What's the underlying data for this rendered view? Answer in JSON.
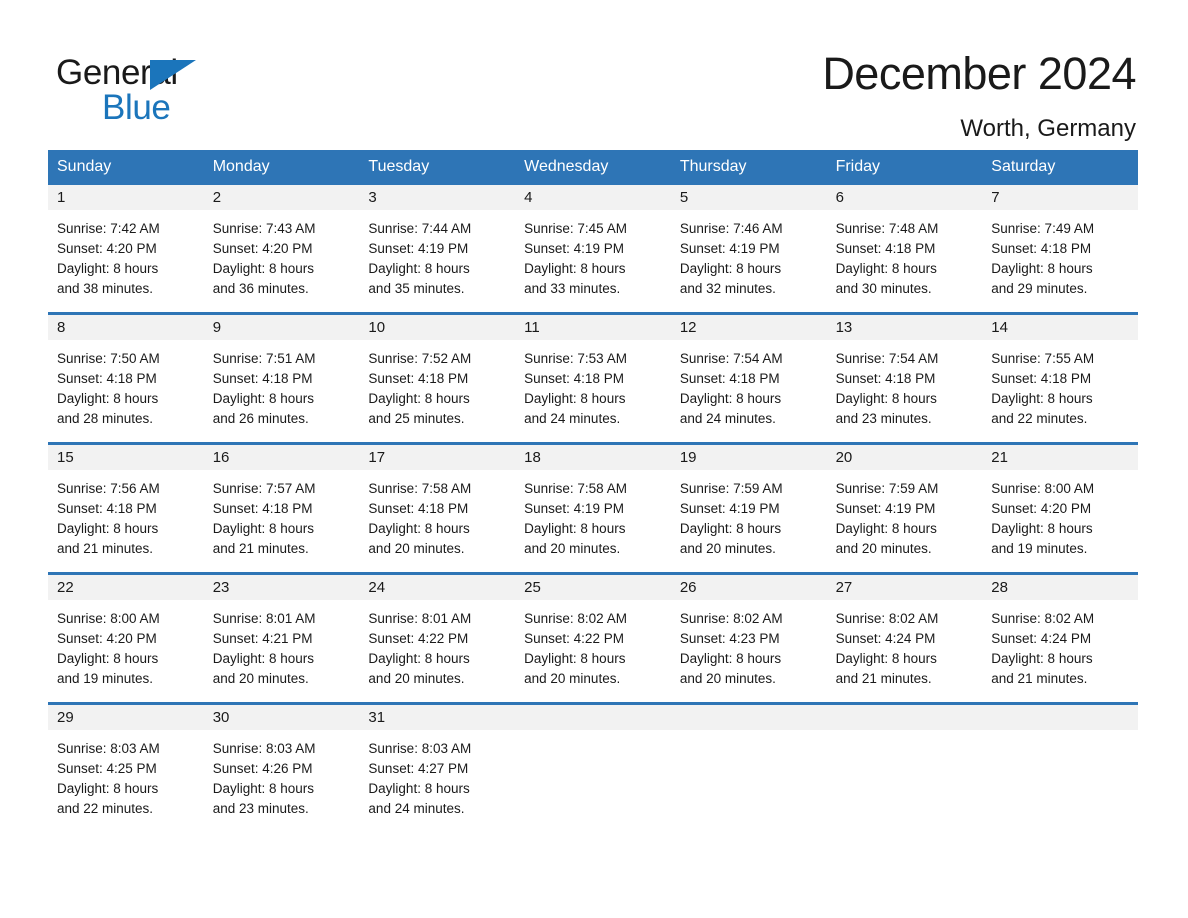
{
  "brand": {
    "name_part1": "General",
    "name_part2": "Blue",
    "accent_color": "#1b75bb"
  },
  "header": {
    "title": "December 2024",
    "location": "Worth, Germany",
    "header_bg_color": "#2e75b6",
    "daynum_bg_color": "#f2f2f2"
  },
  "weekdays": [
    "Sunday",
    "Monday",
    "Tuesday",
    "Wednesday",
    "Thursday",
    "Friday",
    "Saturday"
  ],
  "weeks": [
    [
      {
        "day": "1",
        "sunrise": "Sunrise: 7:42 AM",
        "sunset": "Sunset: 4:20 PM",
        "daylight1": "Daylight: 8 hours",
        "daylight2": "and 38 minutes."
      },
      {
        "day": "2",
        "sunrise": "Sunrise: 7:43 AM",
        "sunset": "Sunset: 4:20 PM",
        "daylight1": "Daylight: 8 hours",
        "daylight2": "and 36 minutes."
      },
      {
        "day": "3",
        "sunrise": "Sunrise: 7:44 AM",
        "sunset": "Sunset: 4:19 PM",
        "daylight1": "Daylight: 8 hours",
        "daylight2": "and 35 minutes."
      },
      {
        "day": "4",
        "sunrise": "Sunrise: 7:45 AM",
        "sunset": "Sunset: 4:19 PM",
        "daylight1": "Daylight: 8 hours",
        "daylight2": "and 33 minutes."
      },
      {
        "day": "5",
        "sunrise": "Sunrise: 7:46 AM",
        "sunset": "Sunset: 4:19 PM",
        "daylight1": "Daylight: 8 hours",
        "daylight2": "and 32 minutes."
      },
      {
        "day": "6",
        "sunrise": "Sunrise: 7:48 AM",
        "sunset": "Sunset: 4:18 PM",
        "daylight1": "Daylight: 8 hours",
        "daylight2": "and 30 minutes."
      },
      {
        "day": "7",
        "sunrise": "Sunrise: 7:49 AM",
        "sunset": "Sunset: 4:18 PM",
        "daylight1": "Daylight: 8 hours",
        "daylight2": "and 29 minutes."
      }
    ],
    [
      {
        "day": "8",
        "sunrise": "Sunrise: 7:50 AM",
        "sunset": "Sunset: 4:18 PM",
        "daylight1": "Daylight: 8 hours",
        "daylight2": "and 28 minutes."
      },
      {
        "day": "9",
        "sunrise": "Sunrise: 7:51 AM",
        "sunset": "Sunset: 4:18 PM",
        "daylight1": "Daylight: 8 hours",
        "daylight2": "and 26 minutes."
      },
      {
        "day": "10",
        "sunrise": "Sunrise: 7:52 AM",
        "sunset": "Sunset: 4:18 PM",
        "daylight1": "Daylight: 8 hours",
        "daylight2": "and 25 minutes."
      },
      {
        "day": "11",
        "sunrise": "Sunrise: 7:53 AM",
        "sunset": "Sunset: 4:18 PM",
        "daylight1": "Daylight: 8 hours",
        "daylight2": "and 24 minutes."
      },
      {
        "day": "12",
        "sunrise": "Sunrise: 7:54 AM",
        "sunset": "Sunset: 4:18 PM",
        "daylight1": "Daylight: 8 hours",
        "daylight2": "and 24 minutes."
      },
      {
        "day": "13",
        "sunrise": "Sunrise: 7:54 AM",
        "sunset": "Sunset: 4:18 PM",
        "daylight1": "Daylight: 8 hours",
        "daylight2": "and 23 minutes."
      },
      {
        "day": "14",
        "sunrise": "Sunrise: 7:55 AM",
        "sunset": "Sunset: 4:18 PM",
        "daylight1": "Daylight: 8 hours",
        "daylight2": "and 22 minutes."
      }
    ],
    [
      {
        "day": "15",
        "sunrise": "Sunrise: 7:56 AM",
        "sunset": "Sunset: 4:18 PM",
        "daylight1": "Daylight: 8 hours",
        "daylight2": "and 21 minutes."
      },
      {
        "day": "16",
        "sunrise": "Sunrise: 7:57 AM",
        "sunset": "Sunset: 4:18 PM",
        "daylight1": "Daylight: 8 hours",
        "daylight2": "and 21 minutes."
      },
      {
        "day": "17",
        "sunrise": "Sunrise: 7:58 AM",
        "sunset": "Sunset: 4:18 PM",
        "daylight1": "Daylight: 8 hours",
        "daylight2": "and 20 minutes."
      },
      {
        "day": "18",
        "sunrise": "Sunrise: 7:58 AM",
        "sunset": "Sunset: 4:19 PM",
        "daylight1": "Daylight: 8 hours",
        "daylight2": "and 20 minutes."
      },
      {
        "day": "19",
        "sunrise": "Sunrise: 7:59 AM",
        "sunset": "Sunset: 4:19 PM",
        "daylight1": "Daylight: 8 hours",
        "daylight2": "and 20 minutes."
      },
      {
        "day": "20",
        "sunrise": "Sunrise: 7:59 AM",
        "sunset": "Sunset: 4:19 PM",
        "daylight1": "Daylight: 8 hours",
        "daylight2": "and 20 minutes."
      },
      {
        "day": "21",
        "sunrise": "Sunrise: 8:00 AM",
        "sunset": "Sunset: 4:20 PM",
        "daylight1": "Daylight: 8 hours",
        "daylight2": "and 19 minutes."
      }
    ],
    [
      {
        "day": "22",
        "sunrise": "Sunrise: 8:00 AM",
        "sunset": "Sunset: 4:20 PM",
        "daylight1": "Daylight: 8 hours",
        "daylight2": "and 19 minutes."
      },
      {
        "day": "23",
        "sunrise": "Sunrise: 8:01 AM",
        "sunset": "Sunset: 4:21 PM",
        "daylight1": "Daylight: 8 hours",
        "daylight2": "and 20 minutes."
      },
      {
        "day": "24",
        "sunrise": "Sunrise: 8:01 AM",
        "sunset": "Sunset: 4:22 PM",
        "daylight1": "Daylight: 8 hours",
        "daylight2": "and 20 minutes."
      },
      {
        "day": "25",
        "sunrise": "Sunrise: 8:02 AM",
        "sunset": "Sunset: 4:22 PM",
        "daylight1": "Daylight: 8 hours",
        "daylight2": "and 20 minutes."
      },
      {
        "day": "26",
        "sunrise": "Sunrise: 8:02 AM",
        "sunset": "Sunset: 4:23 PM",
        "daylight1": "Daylight: 8 hours",
        "daylight2": "and 20 minutes."
      },
      {
        "day": "27",
        "sunrise": "Sunrise: 8:02 AM",
        "sunset": "Sunset: 4:24 PM",
        "daylight1": "Daylight: 8 hours",
        "daylight2": "and 21 minutes."
      },
      {
        "day": "28",
        "sunrise": "Sunrise: 8:02 AM",
        "sunset": "Sunset: 4:24 PM",
        "daylight1": "Daylight: 8 hours",
        "daylight2": "and 21 minutes."
      }
    ],
    [
      {
        "day": "29",
        "sunrise": "Sunrise: 8:03 AM",
        "sunset": "Sunset: 4:25 PM",
        "daylight1": "Daylight: 8 hours",
        "daylight2": "and 22 minutes."
      },
      {
        "day": "30",
        "sunrise": "Sunrise: 8:03 AM",
        "sunset": "Sunset: 4:26 PM",
        "daylight1": "Daylight: 8 hours",
        "daylight2": "and 23 minutes."
      },
      {
        "day": "31",
        "sunrise": "Sunrise: 8:03 AM",
        "sunset": "Sunset: 4:27 PM",
        "daylight1": "Daylight: 8 hours",
        "daylight2": "and 24 minutes."
      },
      {
        "day": "",
        "sunrise": "",
        "sunset": "",
        "daylight1": "",
        "daylight2": ""
      },
      {
        "day": "",
        "sunrise": "",
        "sunset": "",
        "daylight1": "",
        "daylight2": ""
      },
      {
        "day": "",
        "sunrise": "",
        "sunset": "",
        "daylight1": "",
        "daylight2": ""
      },
      {
        "day": "",
        "sunrise": "",
        "sunset": "",
        "daylight1": "",
        "daylight2": ""
      }
    ]
  ]
}
